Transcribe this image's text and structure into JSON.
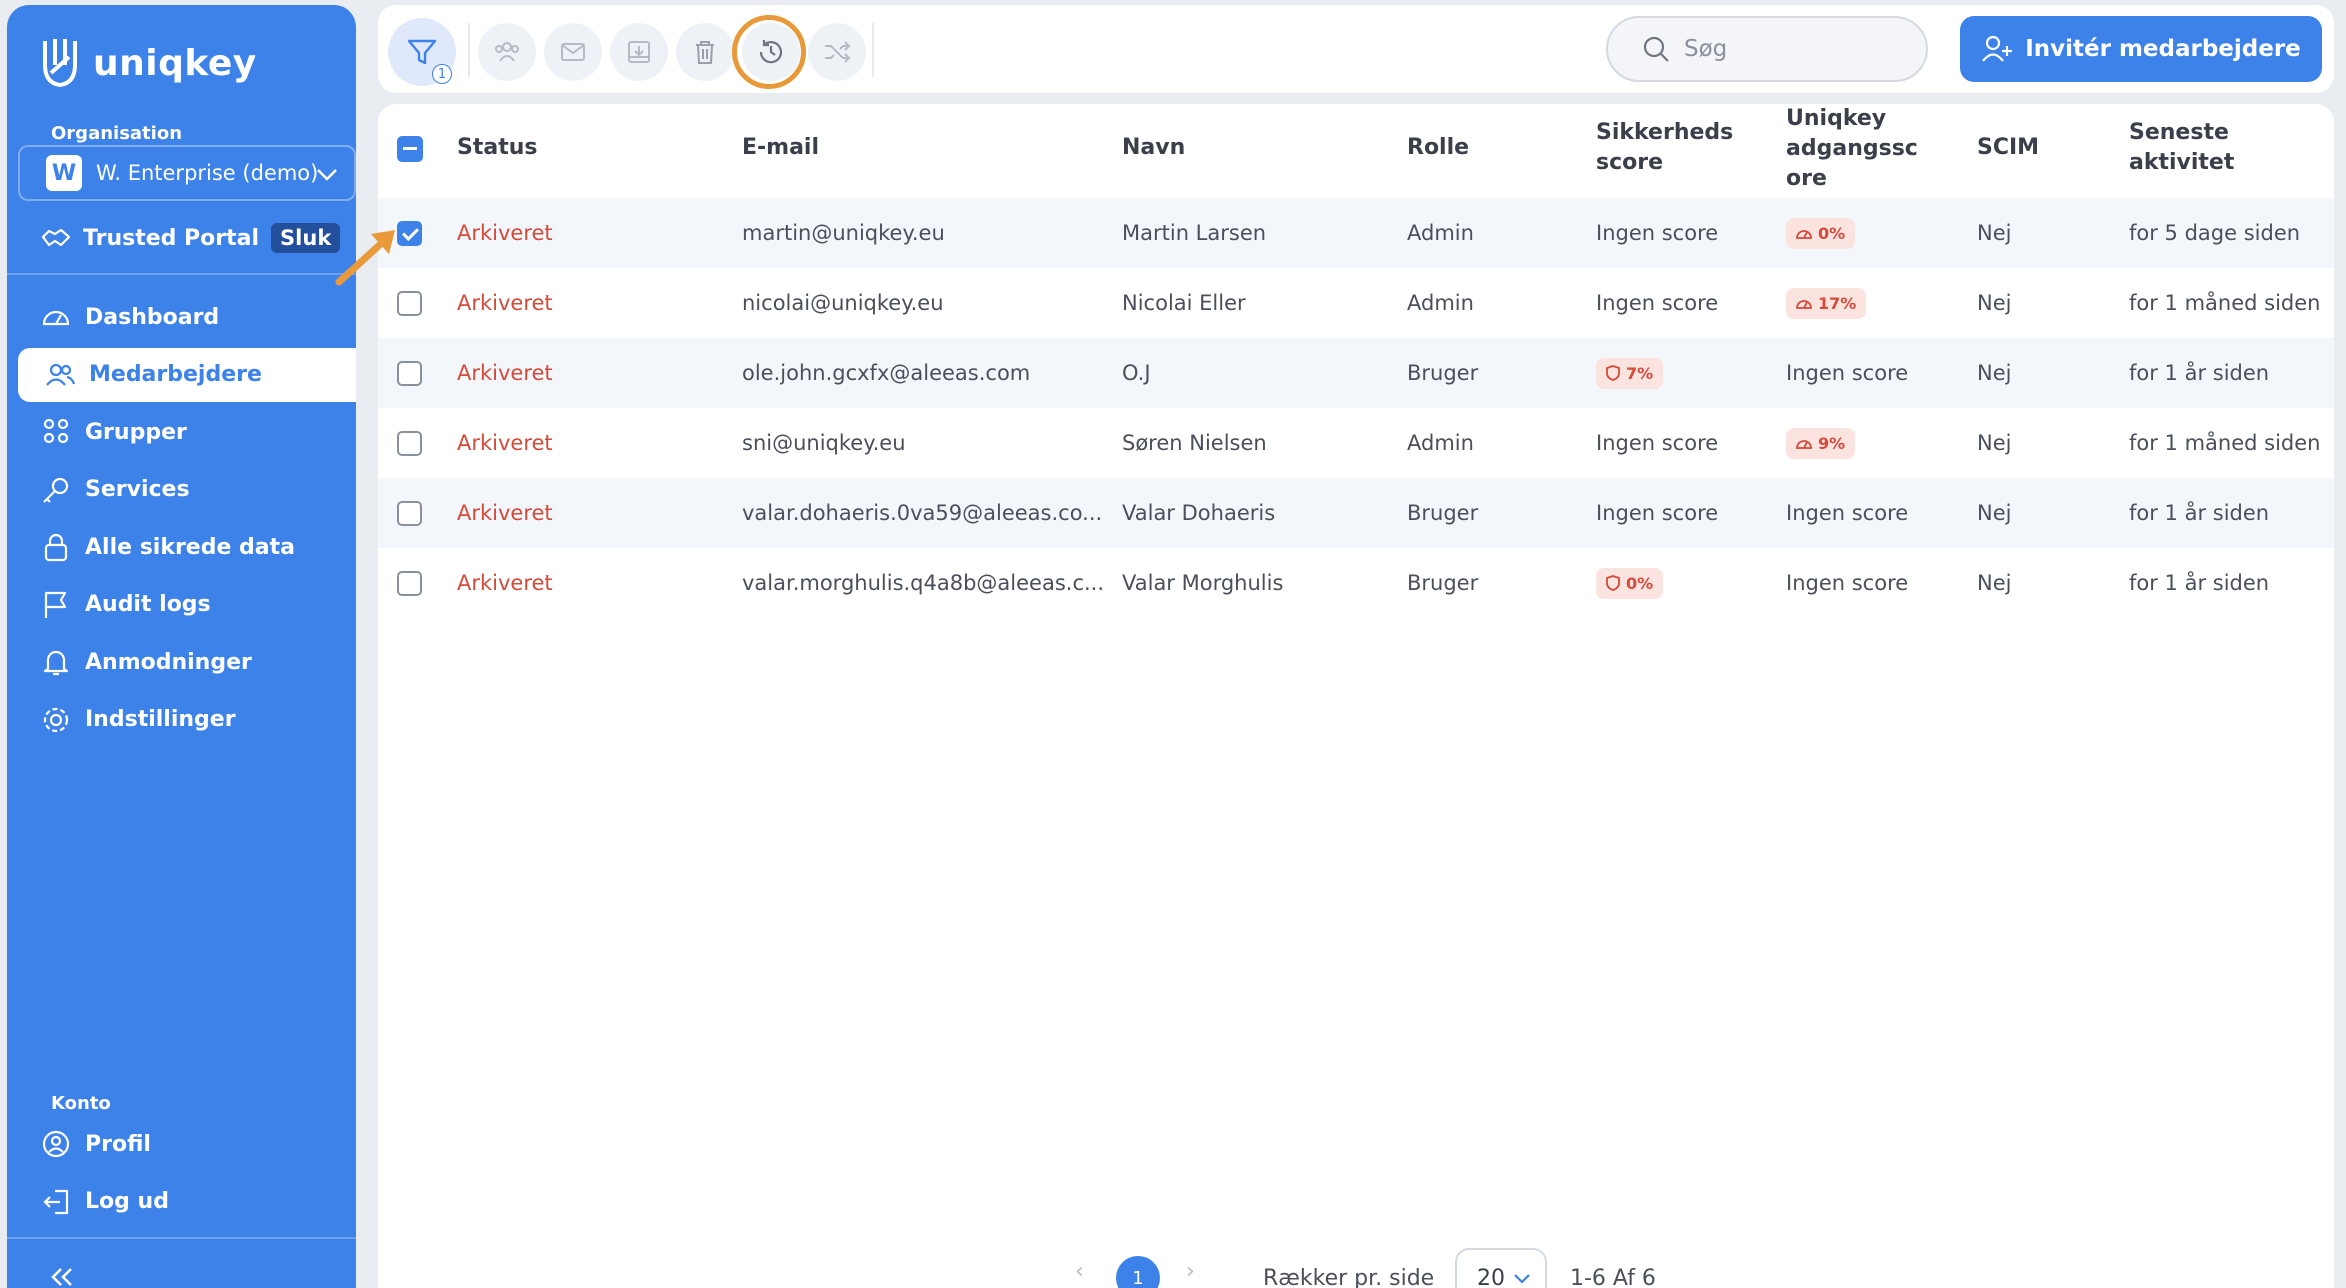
{
  "sidebar": {
    "brand": "uniqkey",
    "org_label": "Organisation",
    "org_initial": "W",
    "org_name": "W. Enterprise (demo)",
    "trusted_portal": "Trusted Portal",
    "trusted_badge": "Sluk",
    "nav": [
      {
        "label": "Dashboard",
        "icon": "dashboard-icon"
      },
      {
        "label": "Medarbejdere",
        "icon": "users-icon",
        "active": true
      },
      {
        "label": "Grupper",
        "icon": "groups-icon"
      },
      {
        "label": "Services",
        "icon": "key-icon"
      },
      {
        "label": "Alle sikrede data",
        "icon": "lock-icon"
      },
      {
        "label": "Audit logs",
        "icon": "flag-icon"
      },
      {
        "label": "Anmodninger",
        "icon": "bell-icon"
      },
      {
        "label": "Indstillinger",
        "icon": "gear-icon"
      }
    ],
    "account_label": "Konto",
    "account": [
      {
        "label": "Profil",
        "icon": "profile-icon"
      },
      {
        "label": "Log ud",
        "icon": "logout-icon"
      }
    ]
  },
  "toolbar": {
    "filter_count": "1",
    "search_placeholder": "Søg",
    "invite_label": "Invitér medarbejdere"
  },
  "table": {
    "headers": {
      "status": "Status",
      "email": "E-mail",
      "name": "Navn",
      "role": "Rolle",
      "security_1": "Sikkerheds",
      "security_2": "score",
      "uniq_1": "Uniqkey",
      "uniq_2": "adgangssc",
      "uniq_3": "ore",
      "scim": "SCIM",
      "activity_1": "Seneste",
      "activity_2": "aktivitet"
    },
    "rows": [
      {
        "checked": true,
        "status": "Arkiveret",
        "email": "martin@uniqkey.eu",
        "name": "Martin Larsen",
        "role": "Admin",
        "security": "Ingen score",
        "uniq": "0%",
        "scim": "Nej",
        "activity": "for 5 dage siden"
      },
      {
        "checked": false,
        "status": "Arkiveret",
        "email": "nicolai@uniqkey.eu",
        "name": "Nicolai Eller",
        "role": "Admin",
        "security": "Ingen score",
        "uniq": "17%",
        "scim": "Nej",
        "activity": "for 1 måned siden"
      },
      {
        "checked": false,
        "status": "Arkiveret",
        "email": "ole.john.gcxfx@aleeas.com",
        "name": "O.J",
        "role": "Bruger",
        "security": "7%",
        "uniq": "Ingen score",
        "scim": "Nej",
        "activity": "for 1 år siden"
      },
      {
        "checked": false,
        "status": "Arkiveret",
        "email": "sni@uniqkey.eu",
        "name": "Søren Nielsen",
        "role": "Admin",
        "security": "Ingen score",
        "uniq": "9%",
        "scim": "Nej",
        "activity": "for 1 måned siden"
      },
      {
        "checked": false,
        "status": "Arkiveret",
        "email": "valar.dohaeris.0va59@aleeas.co...",
        "name": "Valar Dohaeris",
        "role": "Bruger",
        "security": "Ingen score",
        "uniq": "Ingen score",
        "scim": "Nej",
        "activity": "for 1 år siden"
      },
      {
        "checked": false,
        "status": "Arkiveret",
        "email": "valar.morghulis.q4a8b@aleeas.c...",
        "name": "Valar Morghulis",
        "role": "Bruger",
        "security": "0%",
        "uniq": "Ingen score",
        "scim": "Nej",
        "activity": "for 1 år siden"
      }
    ]
  },
  "pagination": {
    "current_page": "1",
    "rows_label": "Rækker pr. side",
    "rows_value": "20",
    "range": "1-6 Af 6"
  },
  "colors": {
    "brand": "#3d82e8",
    "status_red": "#d64a3a",
    "highlight": "#e89a3a"
  }
}
